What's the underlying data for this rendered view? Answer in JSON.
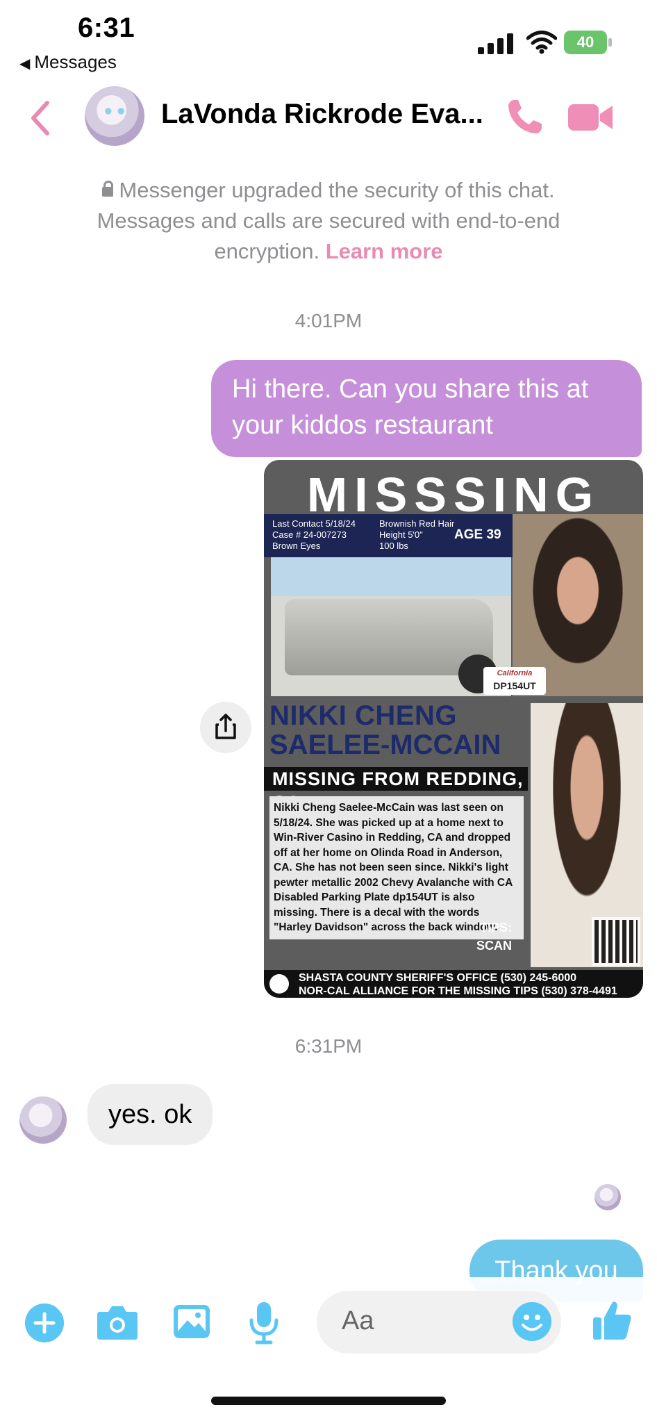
{
  "status_bar": {
    "time": "6:31",
    "back_label": "Messages",
    "battery": "40"
  },
  "header": {
    "contact_name": "LaVonda Rickrode Eva..."
  },
  "security_notice": {
    "text": "Messenger upgraded the security of this chat. Messages and calls are secured with end-to-end encryption.",
    "link": "Learn more"
  },
  "messages": [
    {
      "type": "timestamp",
      "text": "4:01PM"
    },
    {
      "type": "outgoing",
      "text": "Hi there. Can you share this at your kiddos restaurant"
    },
    {
      "type": "outgoing-image",
      "poster": {
        "title": "MISSSING",
        "info_left": [
          "Last Contact 5/18/24",
          "Case # 24-007273",
          "Brown Eyes"
        ],
        "info_right": [
          "Brownish Red Hair",
          "Height 5'0\"",
          "100 lbs"
        ],
        "age": "AGE 39",
        "plate_state": "California",
        "plate": "DP154UT",
        "name_line1": "NIKKI CHENG",
        "name_line2": "SAELEE-MCCAIN",
        "missing_from": "MISSING FROM REDDING, CA",
        "description": "Nikki Cheng Saelee-McCain was last seen on 5/18/24. She was picked up at a home next to Win-River Casino in Redding, CA and dropped off at her home on Olinda Road in Anderson, CA. She has not been seen since. Nikki's light pewter metallic 2002 Chevy Avalanche with CA Disabled Parking Plate dp154UT is also missing. There is a decal with the words \"Harley Davidson\" across the back window.",
        "tips_line1": "TIPS:",
        "tips_line2": "SCAN",
        "footer_line1": "SHASTA COUNTY SHERIFF'S OFFICE (530) 245-6000",
        "footer_line2": "NOR-CAL ALLIANCE FOR THE MISSING TIPS (530) 378-4491"
      }
    },
    {
      "type": "timestamp",
      "text": "6:31PM"
    },
    {
      "type": "incoming",
      "text": "yes. ok"
    },
    {
      "type": "outgoing",
      "text": "Thank you"
    }
  ],
  "composer": {
    "placeholder": "Aa"
  },
  "colors": {
    "accent_pink": "#e88bb3",
    "outgoing_purple": "#c590d9",
    "outgoing_blue": "#6dc7ea",
    "composer_blue": "#5ac6f3"
  },
  "icons": [
    "back-chevron-icon",
    "phone-icon",
    "video-camera-icon",
    "lock-icon",
    "share-icon",
    "plus-icon",
    "camera-icon",
    "photo-icon",
    "microphone-icon",
    "emoji-icon",
    "thumbs-up-icon"
  ]
}
